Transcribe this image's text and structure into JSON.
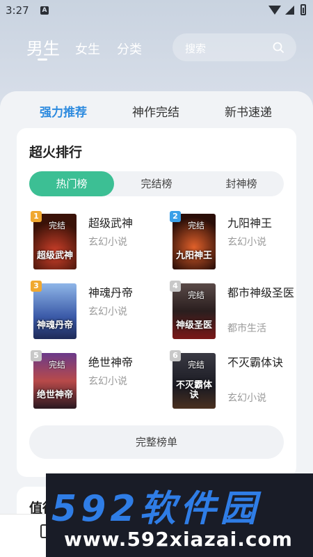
{
  "status_bar": {
    "time": "3:27",
    "notification_badge": "A"
  },
  "header": {
    "tabs": [
      {
        "label": "男生",
        "active": true
      },
      {
        "label": "女生",
        "active": false
      },
      {
        "label": "分类",
        "active": false
      }
    ],
    "search_placeholder": "搜索"
  },
  "sub_tabs": [
    {
      "label": "强力推荐",
      "active": true
    },
    {
      "label": "神作完结",
      "active": false
    },
    {
      "label": "新书速递",
      "active": false
    }
  ],
  "ranking": {
    "title": "超火排行",
    "segments": [
      {
        "label": "热门榜",
        "active": true
      },
      {
        "label": "完结榜",
        "active": false
      },
      {
        "label": "封神榜",
        "active": false
      }
    ],
    "books": [
      {
        "rank": "1",
        "name": "超级武神",
        "genre": "玄幻小说",
        "cover_text": "超级武神",
        "cover_tag": "完结",
        "badge_color": "#f0a830"
      },
      {
        "rank": "2",
        "name": "九阳神王",
        "genre": "玄幻小说",
        "cover_text": "九阳神王",
        "cover_tag": "完结",
        "badge_color": "#3aa0e8"
      },
      {
        "rank": "3",
        "name": "神魂丹帝",
        "genre": "玄幻小说",
        "cover_text": "神魂丹帝",
        "cover_tag": "",
        "badge_color": "#f0a830"
      },
      {
        "rank": "4",
        "name": "都市神级圣医",
        "genre": "都市生活",
        "cover_text": "神级圣医",
        "cover_tag": "完结",
        "badge_color": "#c8c8c8"
      },
      {
        "rank": "5",
        "name": "绝世神帝",
        "genre": "玄幻小说",
        "cover_text": "绝世神帝",
        "cover_tag": "完结",
        "badge_color": "#c8c8c8"
      },
      {
        "rank": "6",
        "name": "不灭霸体诀",
        "genre": "玄幻小说",
        "cover_text": "不灭霸体诀",
        "cover_tag": "完结",
        "badge_color": "#c8c8c8"
      }
    ],
    "full_list_label": "完整榜单"
  },
  "next_section": {
    "title": "值得"
  },
  "watermark": {
    "line1": "592软件园",
    "line2": "www.592xiazai.com"
  },
  "colors": {
    "accent": "#3cbf94",
    "tab_active": "#2e8bdf"
  }
}
